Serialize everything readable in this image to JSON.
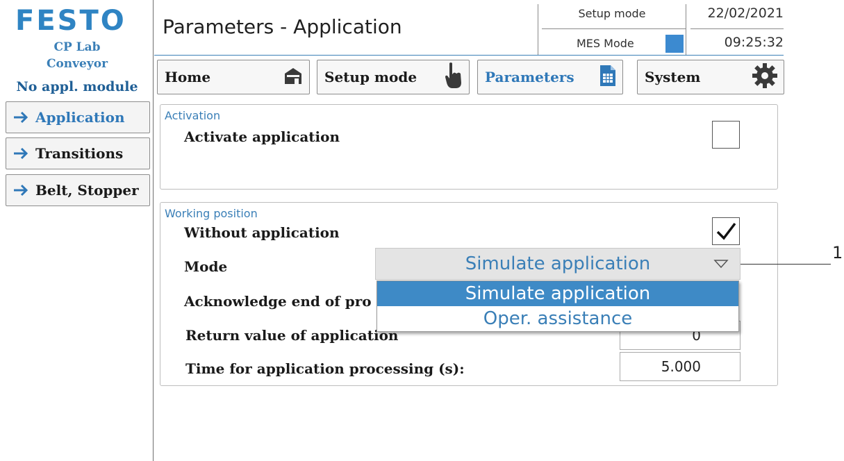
{
  "brand": {
    "logo": "FESTO",
    "station_line1": "CP Lab",
    "station_line2": "Conveyor",
    "module": "No appl. module"
  },
  "sidebar": {
    "items": [
      {
        "label": "Application",
        "active": true
      },
      {
        "label": "Transitions",
        "active": false
      },
      {
        "label": "Belt, Stopper",
        "active": false
      }
    ]
  },
  "header": {
    "title": "Parameters - Application",
    "setup_mode": "Setup mode",
    "mes_mode": "MES Mode",
    "date": "22/02/2021",
    "time": "09:25:32"
  },
  "toolbar": {
    "home": "Home",
    "setup": "Setup mode",
    "parameters": "Parameters",
    "system": "System"
  },
  "activation": {
    "title": "Activation",
    "activate_label": "Activate application",
    "activate_checked": false
  },
  "working": {
    "title": "Working position",
    "without_app_label": "Without application",
    "without_app_checked": true,
    "mode_label": "Mode",
    "mode_value": "Simulate application",
    "mode_options": [
      "Simulate application",
      "Oper. assistance"
    ],
    "ack_label": "Acknowledge end of pro",
    "return_label": "Return value of application",
    "return_value": "0",
    "time_label": "Time for application processing (s):",
    "time_value": "5.000"
  },
  "callout": {
    "number": "1"
  },
  "colors": {
    "festo_blue": "#3a7fb7",
    "selected_blue": "#3e8ac6",
    "mes_indicator": "#3c8ad0"
  }
}
